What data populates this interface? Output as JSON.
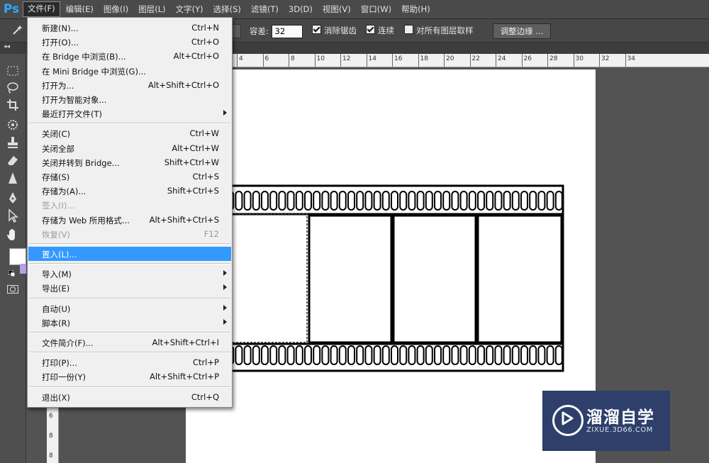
{
  "app": {
    "logo": "Ps"
  },
  "menubar": [
    {
      "label": "文件(F)",
      "active": true
    },
    {
      "label": "编辑(E)"
    },
    {
      "label": "图像(I)"
    },
    {
      "label": "图层(L)"
    },
    {
      "label": "文字(Y)"
    },
    {
      "label": "选择(S)"
    },
    {
      "label": "滤镜(T)"
    },
    {
      "label": "3D(D)"
    },
    {
      "label": "视图(V)"
    },
    {
      "label": "窗口(W)"
    },
    {
      "label": "帮助(H)"
    }
  ],
  "options": {
    "tolerance_label": "容差:",
    "tolerance_value": "32",
    "antialias_label": "消除锯齿",
    "antialias_checked": true,
    "contiguous_label": "连续",
    "contiguous_checked": true,
    "sample_all_label": "对所有图层取样",
    "sample_all_checked": false,
    "refine_edge_label": "调整边缘 ..."
  },
  "ruler_top_labels": [
    "4",
    "6",
    "8",
    "10",
    "12",
    "14",
    "16",
    "18",
    "20",
    "22",
    "24",
    "26",
    "28",
    "30",
    "32",
    "34"
  ],
  "ruler_left_labels": [
    "6",
    "8",
    "8"
  ],
  "watermark": {
    "title": "溜溜自学",
    "url": "ZIXUE.3D66.COM"
  },
  "file_menu": {
    "items": [
      {
        "label": "新建(N)...",
        "shortcut": "Ctrl+N"
      },
      {
        "label": "打开(O)...",
        "shortcut": "Ctrl+O"
      },
      {
        "label": "在 Bridge 中浏览(B)...",
        "shortcut": "Alt+Ctrl+O"
      },
      {
        "label": "在 Mini Bridge 中浏览(G)...",
        "shortcut": ""
      },
      {
        "label": "打开为...",
        "shortcut": "Alt+Shift+Ctrl+O"
      },
      {
        "label": "打开为智能对象...",
        "shortcut": ""
      },
      {
        "label": "最近打开文件(T)",
        "shortcut": "",
        "submenu": true
      },
      {
        "label": "关闭(C)",
        "shortcut": "Ctrl+W",
        "sep_before": true
      },
      {
        "label": "关闭全部",
        "shortcut": "Alt+Ctrl+W"
      },
      {
        "label": "关闭并转到 Bridge...",
        "shortcut": "Shift+Ctrl+W"
      },
      {
        "label": "存储(S)",
        "shortcut": "Ctrl+S"
      },
      {
        "label": "存储为(A)...",
        "shortcut": "Shift+Ctrl+S"
      },
      {
        "label": "签入(I)...",
        "shortcut": "",
        "disabled": true
      },
      {
        "label": "存储为 Web 所用格式...",
        "shortcut": "Alt+Shift+Ctrl+S"
      },
      {
        "label": "恢复(V)",
        "shortcut": "F12",
        "disabled": true
      },
      {
        "label": "置入(L)...",
        "shortcut": "",
        "sep_before": true,
        "highlighted": true
      },
      {
        "label": "导入(M)",
        "shortcut": "",
        "submenu": true,
        "sep_before": true
      },
      {
        "label": "导出(E)",
        "shortcut": "",
        "submenu": true
      },
      {
        "label": "自动(U)",
        "shortcut": "",
        "submenu": true,
        "sep_before": true
      },
      {
        "label": "脚本(R)",
        "shortcut": "",
        "submenu": true
      },
      {
        "label": "文件简介(F)...",
        "shortcut": "Alt+Shift+Ctrl+I",
        "sep_before": true
      },
      {
        "label": "打印(P)...",
        "shortcut": "Ctrl+P",
        "sep_before": true
      },
      {
        "label": "打印一份(Y)",
        "shortcut": "Alt+Shift+Ctrl+P"
      },
      {
        "label": "退出(X)",
        "shortcut": "Ctrl+Q",
        "sep_before": true
      }
    ]
  },
  "colors": {
    "highlight": "#3399ff",
    "watermark_bg": "#2d3f6a",
    "ps_blue": "#31a8ff"
  }
}
